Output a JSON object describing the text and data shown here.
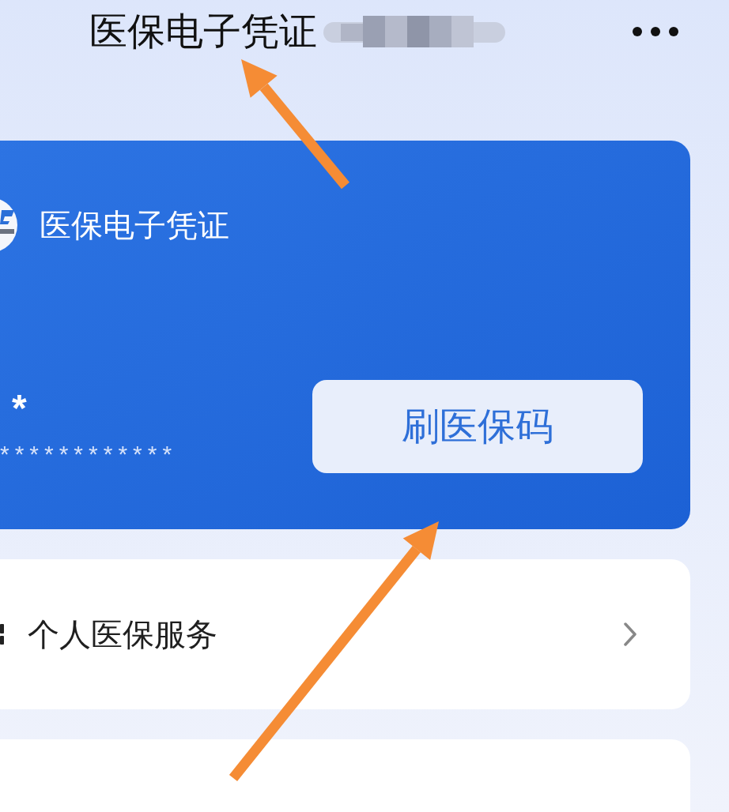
{
  "header": {
    "title": "医保电子凭证"
  },
  "card": {
    "title": "医保电子凭证",
    "holder_name": "*",
    "id_number": "************",
    "button": "刷医保码"
  },
  "services": [
    {
      "label": "个人医保服务"
    }
  ]
}
